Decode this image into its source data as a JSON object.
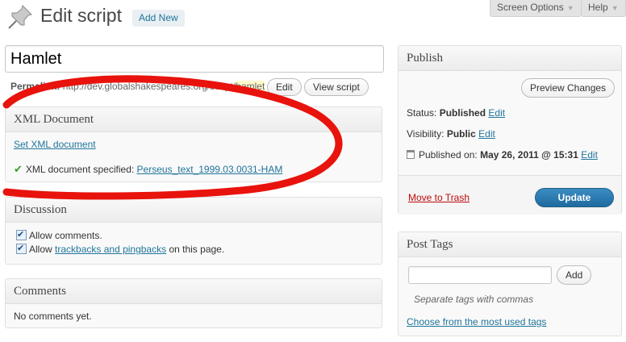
{
  "header": {
    "title": "Edit script",
    "add_new": "Add New",
    "screen_options": "Screen Options",
    "help": "Help"
  },
  "post": {
    "title_value": "Hamlet",
    "permalink_label": "Permalink:",
    "permalink_base": "http://dev.globalshakespeares.org/script/",
    "permalink_slug": "hamlet",
    "edit_label": "Edit",
    "view_label": "View script"
  },
  "xml_document": {
    "heading": "XML Document",
    "set_link": "Set XML document",
    "specified_label": "XML document specified:",
    "specified_value": "Perseus_text_1999.03.0031-HAM"
  },
  "discussion": {
    "heading": "Discussion",
    "allow_comments": "Allow comments.",
    "allow_prefix": "Allow",
    "trackbacks_link": "trackbacks and pingbacks",
    "allow_suffix": "on this page."
  },
  "comments": {
    "heading": "Comments",
    "empty": "No comments yet."
  },
  "publish": {
    "heading": "Publish",
    "preview": "Preview Changes",
    "status_label": "Status:",
    "status_value": "Published",
    "visibility_label": "Visibility:",
    "visibility_value": "Public",
    "published_label": "Published on:",
    "published_value": "May 26, 2011 @ 15:31",
    "edit": "Edit",
    "trash": "Move to Trash",
    "update": "Update"
  },
  "post_tags": {
    "heading": "Post Tags",
    "add": "Add",
    "hint": "Separate tags with commas",
    "choose_link": "Choose from the most used tags"
  },
  "colors": {
    "link": "#21759b",
    "annotation_circle": "#e8130c",
    "update_button": "#2a7ab0"
  }
}
